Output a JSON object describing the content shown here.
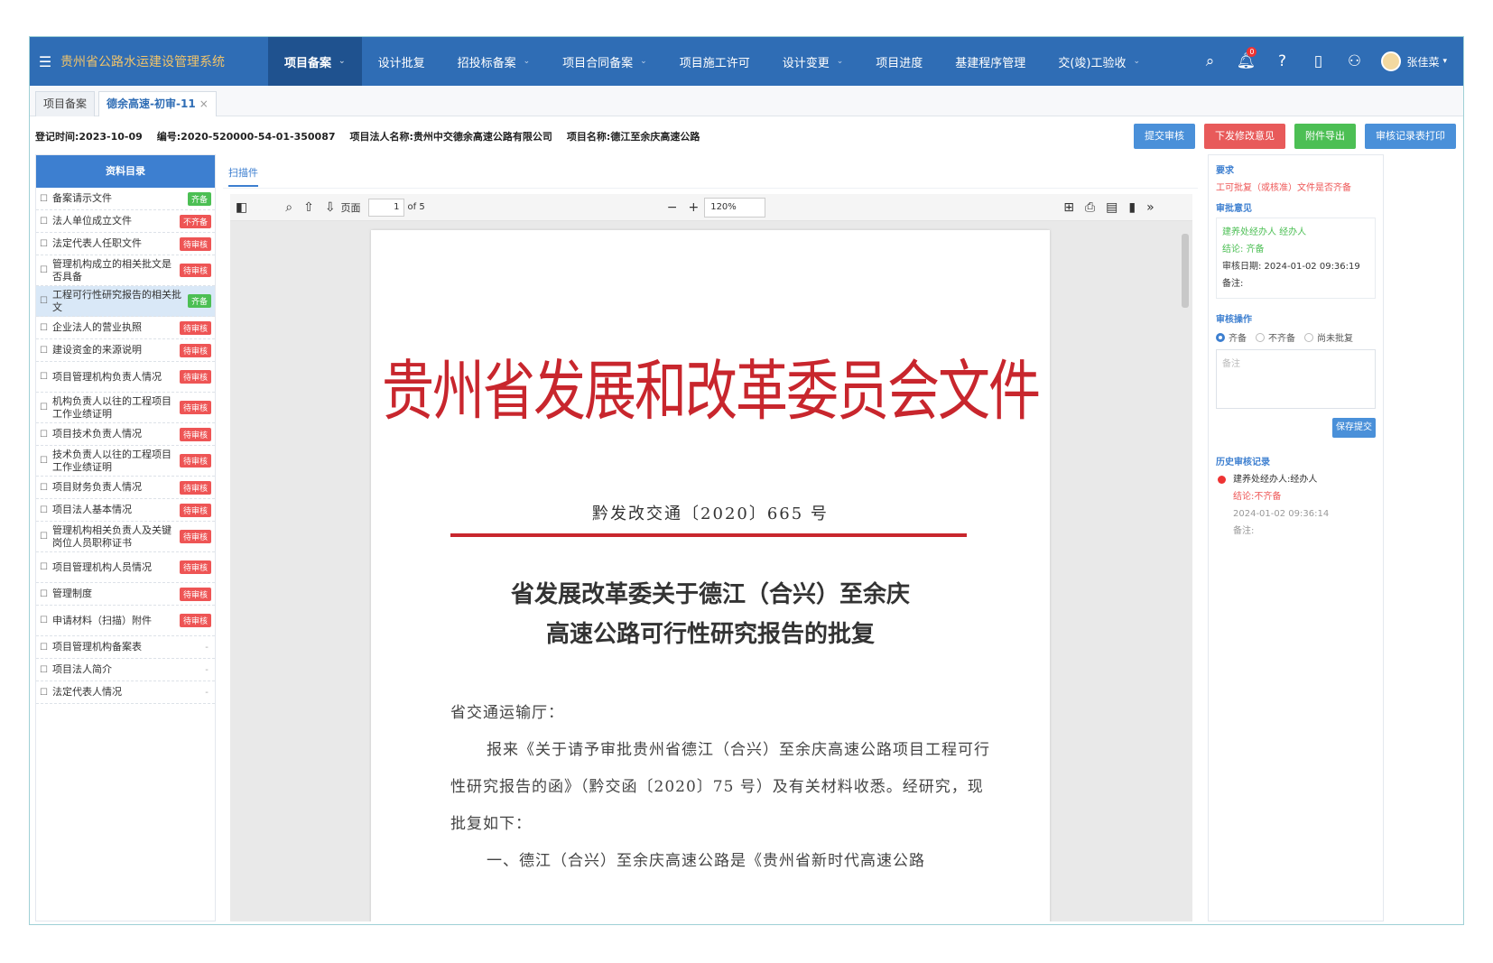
{
  "app": {
    "title": "贵州省公路水运建设管理系统"
  },
  "nav": {
    "items": [
      {
        "label": "项目备案",
        "active": true,
        "caret": true
      },
      {
        "label": "设计批复",
        "active": false,
        "caret": false
      },
      {
        "label": "招投标备案",
        "active": false,
        "caret": true
      },
      {
        "label": "项目合同备案",
        "active": false,
        "caret": true
      },
      {
        "label": "项目施工许可",
        "active": false,
        "caret": false
      },
      {
        "label": "设计变更",
        "active": false,
        "caret": true
      },
      {
        "label": "项目进度",
        "active": false,
        "caret": false
      },
      {
        "label": "基建程序管理",
        "active": false,
        "caret": false
      },
      {
        "label": "交(竣)工验收",
        "active": false,
        "caret": true
      }
    ],
    "notification_count": "0",
    "user_name": "张佳菜"
  },
  "tabs": [
    {
      "label": "项目备案",
      "active": false
    },
    {
      "label": "德余高速-初审-11",
      "active": true
    }
  ],
  "info": {
    "register_time": "登记时间:2023-10-09",
    "code": "编号:2020-520000-54-01-350087",
    "legal_entity": "项目法人名称:贵州中交德余高速公路有限公司",
    "project_name": "项目名称:德江至余庆高速公路"
  },
  "actions": {
    "submit": "提交审核",
    "issue": "下发修改意见",
    "export": "附件导出",
    "print": "审核记录表打印"
  },
  "catalog": {
    "title": "资料目录",
    "items": [
      {
        "label": "备案请示文件",
        "tag": "齐备",
        "status": "ok"
      },
      {
        "label": "法人单位成立文件",
        "tag": "不齐备",
        "status": "bad"
      },
      {
        "label": "法定代表人任职文件",
        "tag": "待审核",
        "status": "bad"
      },
      {
        "label": "管理机构成立的相关批文是否具备",
        "tag": "待审核",
        "status": "bad"
      },
      {
        "label": "工程可行性研究报告的相关批文",
        "tag": "齐备",
        "status": "ok",
        "selected": true
      },
      {
        "label": "企业法人的营业执照",
        "tag": "待审核",
        "status": "bad"
      },
      {
        "label": "建设资金的来源说明",
        "tag": "待审核",
        "status": "bad"
      },
      {
        "label": "项目管理机构负责人情况",
        "tag": "待审核",
        "status": "bad"
      },
      {
        "label": "机构负责人以往的工程项目工作业绩证明",
        "tag": "待审核",
        "status": "bad"
      },
      {
        "label": "项目技术负责人情况",
        "tag": "待审核",
        "status": "bad"
      },
      {
        "label": "技术负责人以往的工程项目工作业绩证明",
        "tag": "待审核",
        "status": "bad"
      },
      {
        "label": "项目财务负责人情况",
        "tag": "待审核",
        "status": "bad"
      },
      {
        "label": "项目法人基本情况",
        "tag": "待审核",
        "status": "bad"
      },
      {
        "label": "管理机构相关负责人及关键岗位人员职称证书",
        "tag": "待审核",
        "status": "bad"
      },
      {
        "label": "项目管理机构人员情况",
        "tag": "待审核",
        "status": "bad"
      },
      {
        "label": "管理制度",
        "tag": "待审核",
        "status": "bad"
      },
      {
        "label": "申请材料（扫描）附件",
        "tag": "待审核",
        "status": "bad"
      },
      {
        "label": "项目管理机构备案表",
        "tag": "-",
        "status": "none"
      },
      {
        "label": "项目法人简介",
        "tag": "-",
        "status": "none"
      },
      {
        "label": "法定代表人情况",
        "tag": "-",
        "status": "none"
      }
    ]
  },
  "viewer": {
    "tab": "扫描件",
    "page_label": "页面",
    "page_current": "1",
    "page_total": "of 5",
    "zoom": "120%",
    "document": {
      "header": "贵州省发展和改革委员会文件",
      "number": "黔发改交通〔2020〕665 号",
      "title_line1": "省发展改革委关于德江（合兴）至余庆",
      "title_line2": "高速公路可行性研究报告的批复",
      "body": [
        "省交通运输厅：",
        "报来《关于请予审批贵州省德江（合兴）至余庆高速公路项目工程可行性研究报告的函》（黔交函〔2020〕75 号）及有关材料收悉。经研究，现批复如下：",
        "一、德江（合兴）至余庆高速公路是《贵州省新时代高速公路"
      ]
    }
  },
  "side": {
    "requirement_title": "要求",
    "requirement_text": "工可批复（或核准）文件是否齐备",
    "opinion_title": "审批意见",
    "opinion_person": "建养处经办人  经办人",
    "opinion_result": "结论: 齐备",
    "opinion_date": "审核日期: 2024-01-02 09:36:19",
    "opinion_note": "备注:",
    "operation_title": "审核操作",
    "radio_options": [
      "齐备",
      "不齐备",
      "尚未批复"
    ],
    "note_placeholder": "备注",
    "save_button": "保存提交",
    "history_title": "历史审核记录",
    "history": {
      "person": "建养处经办人:经办人",
      "result": "结论:不齐备",
      "date": "2024-01-02 09:36:14",
      "note": "备注:"
    }
  }
}
